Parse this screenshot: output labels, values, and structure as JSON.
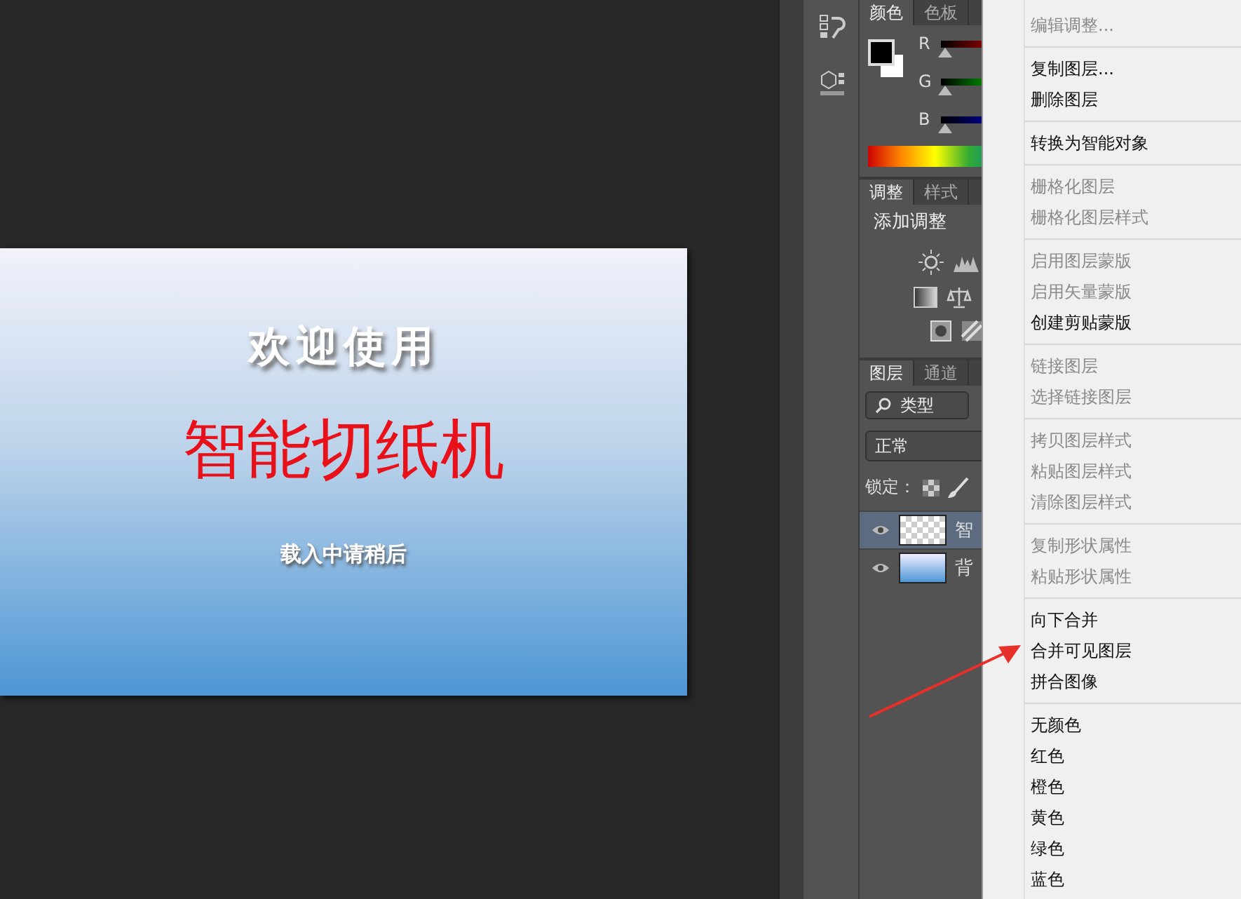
{
  "canvas": {
    "heading": "欢迎使用",
    "title": "智能切纸机",
    "subtitle": "载入中请稍后"
  },
  "color_panel": {
    "tabs": [
      {
        "label": "颜色",
        "selected": true
      },
      {
        "label": "色板",
        "selected": false
      }
    ],
    "sliders": [
      {
        "label": "R",
        "level": 0
      },
      {
        "label": "G",
        "level": 0
      },
      {
        "label": "B",
        "level": 0
      }
    ]
  },
  "adjustments_panel": {
    "tabs": [
      {
        "label": "调整",
        "selected": true
      },
      {
        "label": "样式",
        "selected": false
      }
    ],
    "heading": "添加调整"
  },
  "layers_panel": {
    "tabs": [
      {
        "label": "图层",
        "selected": true
      },
      {
        "label": "通道",
        "selected": false
      }
    ],
    "filter": "类型",
    "blend_mode": "正常",
    "lock_label": "锁定：",
    "layers": [
      {
        "name": "智",
        "visible": true,
        "selected": true,
        "kind": "text"
      },
      {
        "name": "背",
        "visible": true,
        "selected": false,
        "kind": "background"
      }
    ]
  },
  "context_menu": {
    "groups": [
      [
        {
          "label": "编辑调整...",
          "disabled": true
        }
      ],
      [
        {
          "label": "复制图层...",
          "disabled": false
        },
        {
          "label": "删除图层",
          "disabled": false
        }
      ],
      [
        {
          "label": "转换为智能对象",
          "disabled": false
        }
      ],
      [
        {
          "label": "栅格化图层",
          "disabled": true
        },
        {
          "label": "栅格化图层样式",
          "disabled": true
        }
      ],
      [
        {
          "label": "启用图层蒙版",
          "disabled": true
        },
        {
          "label": "启用矢量蒙版",
          "disabled": true
        },
        {
          "label": "创建剪贴蒙版",
          "disabled": false
        }
      ],
      [
        {
          "label": "链接图层",
          "disabled": true
        },
        {
          "label": "选择链接图层",
          "disabled": true
        }
      ],
      [
        {
          "label": "拷贝图层样式",
          "disabled": true
        },
        {
          "label": "粘贴图层样式",
          "disabled": true
        },
        {
          "label": "清除图层样式",
          "disabled": true
        }
      ],
      [
        {
          "label": "复制形状属性",
          "disabled": true
        },
        {
          "label": "粘贴形状属性",
          "disabled": true
        }
      ],
      [
        {
          "label": "向下合并",
          "disabled": false
        },
        {
          "label": "合并可见图层",
          "disabled": false
        },
        {
          "label": "拼合图像",
          "disabled": false
        }
      ],
      [
        {
          "label": "无颜色",
          "disabled": false
        },
        {
          "label": "红色",
          "disabled": false
        },
        {
          "label": "橙色",
          "disabled": false
        },
        {
          "label": "黄色",
          "disabled": false
        },
        {
          "label": "绿色",
          "disabled": false
        },
        {
          "label": "蓝色",
          "disabled": false
        }
      ]
    ]
  }
}
